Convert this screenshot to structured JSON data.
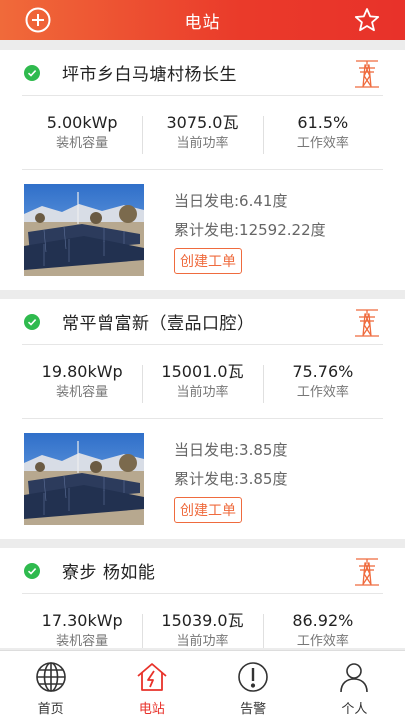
{
  "header": {
    "title": "电站",
    "add_icon": "plus-circle-icon",
    "favorite_icon": "star-icon"
  },
  "colors": {
    "accent": "#e8322a",
    "success": "#2fba4e",
    "ticket": "#ef6b3e"
  },
  "stations": [
    {
      "name": "坪市乡白马塘村杨长生",
      "capacity": "5.00kWp",
      "capacity_label": "装机容量",
      "power": "3075.0瓦",
      "power_label": "当前功率",
      "efficiency": "61.5%",
      "efficiency_label": "工作效率",
      "daily": "当日发电:6.41度",
      "total": "累计发电:12592.22度",
      "ticket_label": "创建工单"
    },
    {
      "name": "常平曾富新（壹品口腔）",
      "capacity": "19.80kWp",
      "capacity_label": "装机容量",
      "power": "15001.0瓦",
      "power_label": "当前功率",
      "efficiency": "75.76%",
      "efficiency_label": "工作效率",
      "daily": "当日发电:3.85度",
      "total": "累计发电:3.85度",
      "ticket_label": "创建工单"
    },
    {
      "name": "寮步 杨如能",
      "capacity": "17.30kWp",
      "capacity_label": "装机容量",
      "power": "15039.0瓦",
      "power_label": "当前功率",
      "efficiency": "86.92%",
      "efficiency_label": "工作效率"
    }
  ],
  "tabs": [
    {
      "label": "首页",
      "icon": "globe-icon",
      "active": false
    },
    {
      "label": "电站",
      "icon": "power-station-icon",
      "active": true
    },
    {
      "label": "告警",
      "icon": "alert-icon",
      "active": false
    },
    {
      "label": "个人",
      "icon": "user-icon",
      "active": false
    }
  ]
}
